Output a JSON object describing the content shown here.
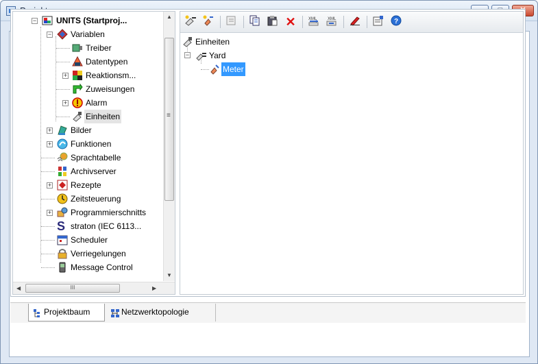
{
  "window": {
    "title": "Projektmanager",
    "buttons": {
      "minimize": "▭",
      "maximize": "□",
      "close": "✕"
    }
  },
  "left_tree": {
    "root": "UNITS (Startproj...",
    "items": [
      {
        "label": "Variablen",
        "icon": "variables-icon"
      },
      {
        "label": "Treiber",
        "icon": "driver-icon"
      },
      {
        "label": "Datentypen",
        "icon": "datatypes-icon"
      },
      {
        "label": "Reaktionsm...",
        "icon": "reaction-matrix-icon"
      },
      {
        "label": "Zuweisungen",
        "icon": "assignments-icon"
      },
      {
        "label": "Alarm",
        "icon": "alarm-icon"
      },
      {
        "label": "Einheiten",
        "icon": "units-icon"
      },
      {
        "label": "Bilder",
        "icon": "screens-icon"
      },
      {
        "label": "Funktionen",
        "icon": "functions-icon"
      },
      {
        "label": "Sprachtabelle",
        "icon": "language-table-icon"
      },
      {
        "label": "Archivserver",
        "icon": "archive-server-icon"
      },
      {
        "label": "Rezepte",
        "icon": "recipes-icon"
      },
      {
        "label": "Zeitsteuerung",
        "icon": "time-control-icon"
      },
      {
        "label": "Programmierschnitts",
        "icon": "programming-interface-icon"
      },
      {
        "label": "straton (IEC 6113...",
        "icon": "straton-icon"
      },
      {
        "label": "Scheduler",
        "icon": "scheduler-icon"
      },
      {
        "label": "Verriegelungen",
        "icon": "interlocking-icon"
      },
      {
        "label": "Message Control",
        "icon": "message-control-icon"
      }
    ],
    "scroll_grip": "≡",
    "hscroll_grip": "III"
  },
  "right_tree": {
    "root": "Einheiten",
    "child": "Yard",
    "grandchild": "Meter"
  },
  "tabs": [
    {
      "label": "Projektbaum",
      "icon": "tree-icon"
    },
    {
      "label": "Netzwerktopologie",
      "icon": "network-icon"
    }
  ],
  "colors": {
    "selection": "#3399ff",
    "accent": "#3b7bd0"
  }
}
